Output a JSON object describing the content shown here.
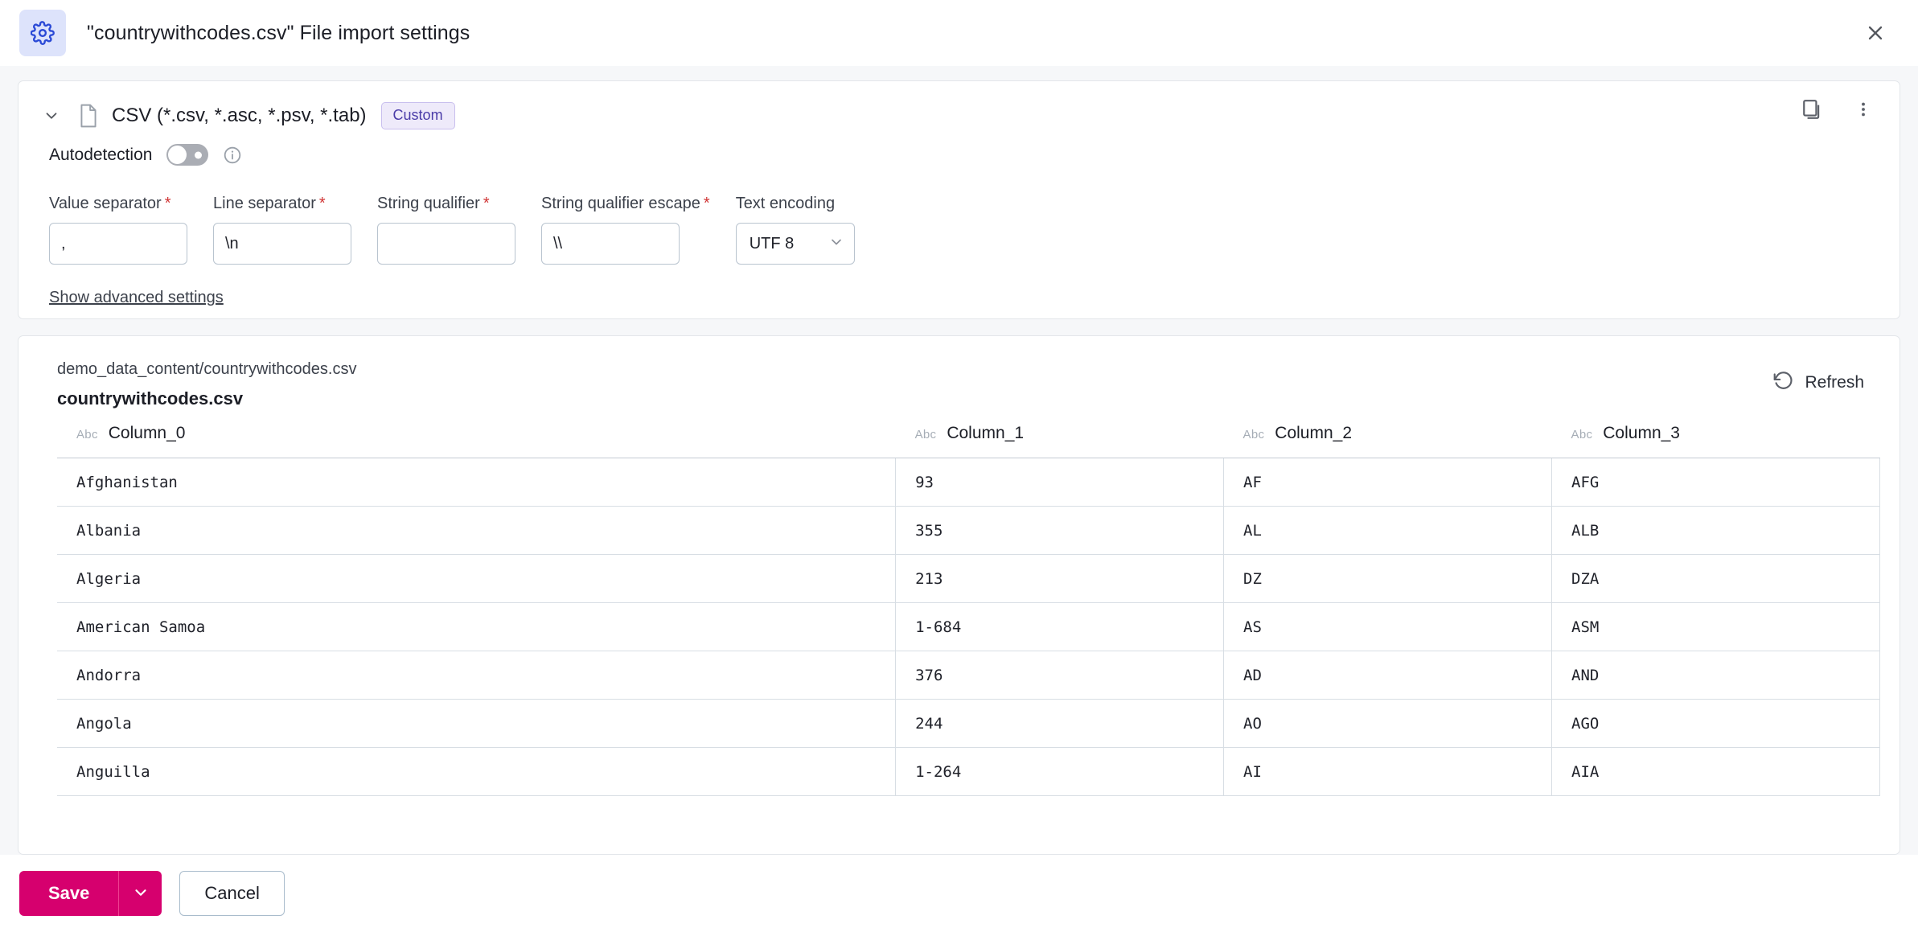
{
  "window": {
    "title": "\"countrywithcodes.csv\" File import settings",
    "settings_icon": "gear-icon",
    "close_icon": "close-icon"
  },
  "format_section": {
    "collapse_icon": "chevron-down-icon",
    "file_icon": "file-icon",
    "label": "CSV (*.csv, *.asc, *.psv, *.tab)",
    "badge": "Custom",
    "duplicate_icon": "copy-icon",
    "more_icon": "more-vertical-icon",
    "autodetection": {
      "label": "Autodetection",
      "state": "off",
      "info_icon": "info-icon"
    },
    "fields": [
      {
        "label": "Value separator",
        "required": "*",
        "value": ",",
        "name": "value-separator"
      },
      {
        "label": "Line separator",
        "required": "*",
        "value": "\\n",
        "name": "line-separator"
      },
      {
        "label": "String qualifier",
        "required": "*",
        "value": "",
        "name": "string-qualifier"
      },
      {
        "label": "String qualifier escape",
        "required": "*",
        "value": "\\\\",
        "name": "string-qualifier-escape"
      }
    ],
    "encoding": {
      "label": "Text encoding",
      "value": "UTF 8",
      "caret_icon": "chevron-down-icon"
    },
    "advanced_link": "Show advanced settings"
  },
  "preview": {
    "path": "demo_data_content/countrywithcodes.csv",
    "file_name": "countrywithcodes.csv",
    "refresh_label": "Refresh",
    "refresh_icon": "rotate-ccw-icon",
    "type_tag": "Abc",
    "columns": [
      "Column_0",
      "Column_1",
      "Column_2",
      "Column_3"
    ],
    "rows": [
      [
        "Afghanistan",
        "93",
        "AF",
        "AFG"
      ],
      [
        "Albania",
        "355",
        "AL",
        "ALB"
      ],
      [
        "Algeria",
        "213",
        "DZ",
        "DZA"
      ],
      [
        "American Samoa",
        "1-684",
        "AS",
        "ASM"
      ],
      [
        "Andorra",
        "376",
        "AD",
        "AND"
      ],
      [
        "Angola",
        "244",
        "AO",
        "AGO"
      ],
      [
        "Anguilla",
        "1-264",
        "AI",
        "AIA"
      ]
    ]
  },
  "footer": {
    "save_label": "Save",
    "save_caret_icon": "chevron-down-icon",
    "cancel_label": "Cancel"
  },
  "colors": {
    "accent_save": "#d6006e",
    "badge_bg": "#eeeafa",
    "badge_text": "#4a3ca8",
    "title_icon_bg": "#dde3fb",
    "required_star": "#d03434"
  }
}
